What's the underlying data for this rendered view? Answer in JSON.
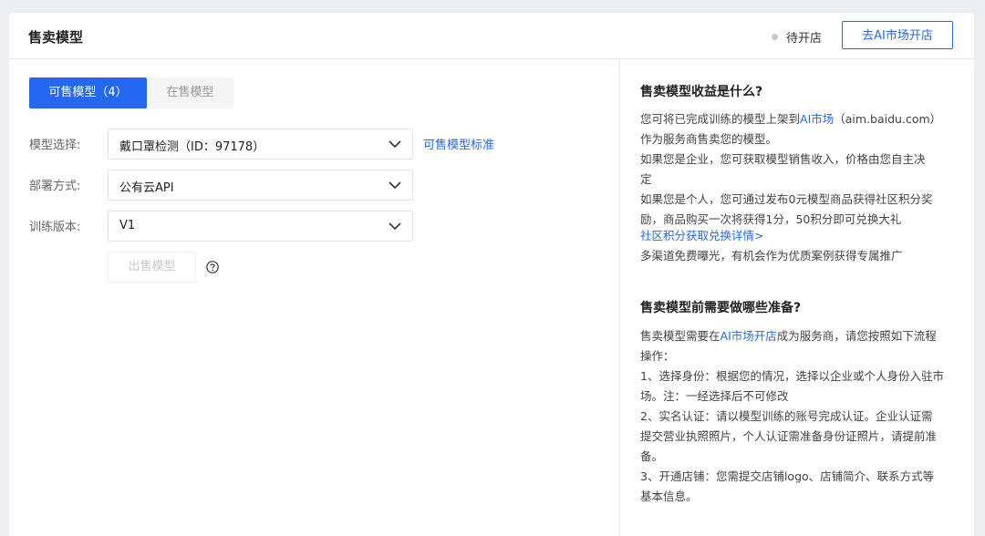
{
  "header": {
    "title": "售卖模型",
    "status_text": "待开店",
    "open_store_button": "去AI市场开店"
  },
  "tabs": [
    {
      "label": "可售模型（4）",
      "active": true
    },
    {
      "label": "在售模型",
      "active": false
    }
  ],
  "form": {
    "model_label": "模型选择:",
    "model_value": "戴口罩检测（ID：97178）",
    "model_standard_link": "可售模型标准",
    "deploy_label": "部署方式:",
    "deploy_value": "公有云API",
    "version_label": "训练版本:",
    "version_value": "V1",
    "sell_button": "出售模型"
  },
  "info": {
    "section1_title": "售卖模型收益是什么?",
    "s1_line1_a": "您可将已完成训练的模型上架到",
    "s1_line1_link": "AI市场",
    "s1_line1_b": "（aim.baidu.com）",
    "s1_line2": "作为服务商售卖您的模型。",
    "s1_line3": "如果您是企业，您可获取模型销售收入，价格由您自主决",
    "s1_line4": "定",
    "s1_line5": "如果您是个人，您可通过发布0元模型商品获得社区积分奖",
    "s1_line6": "励，商品购买一次将获得1分，50积分即可兑换大礼",
    "s1_line7_link": "社区积分获取兑换详情>",
    "s1_line8": "多渠道免费曝光，有机会作为优质案例获得专属推广",
    "section2_title": "售卖模型前需要做哪些准备?",
    "s2_line1_a": "售卖模型需要在",
    "s2_line1_link": "AI市场开店",
    "s2_line1_b": "成为服务商，请您按照如下流程",
    "s2_line2": "操作：",
    "s2_line3": "1、选择身份：根据您的情况，选择以企业或个人身份入驻市",
    "s2_line4": "场。注：一经选择后不可修改",
    "s2_line5": "2、实名认证：请以模型训练的账号完成认证。企业认证需",
    "s2_line6": "提交营业执照照片，个人认证需准备身份证照片，请提前准",
    "s2_line7": "备。",
    "s2_line8": "3、开通店铺：您需提交店铺logo、店铺简介、联系方式等",
    "s2_line9": "基本信息。"
  },
  "colors": {
    "accent": "#2468f2",
    "status_dot": "#c8c8c8"
  }
}
